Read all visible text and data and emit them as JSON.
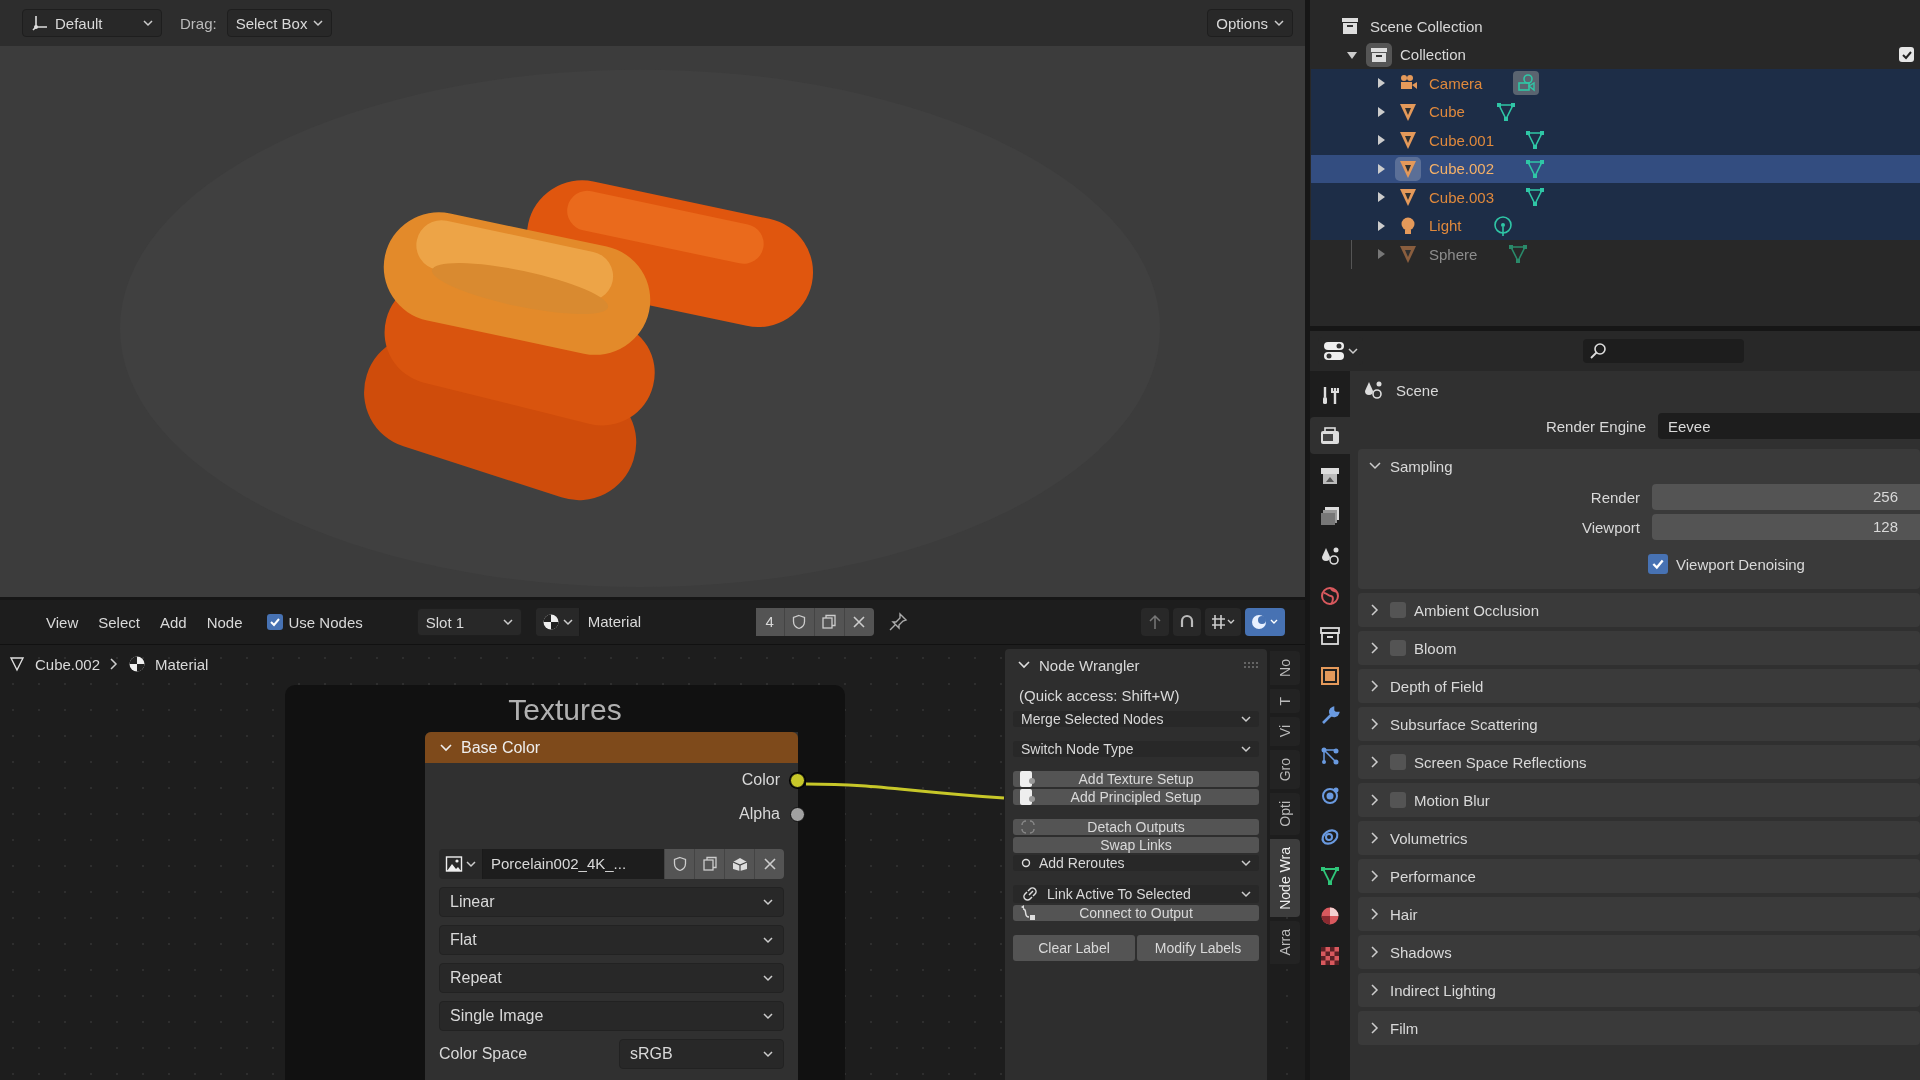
{
  "viewport": {
    "kind": "picture",
    "orientation": "Default",
    "drag_label": "Drag:",
    "drag_mode": "Select Box",
    "options": "Options"
  },
  "outliner": {
    "root": "Scene Collection",
    "collection": {
      "name": "Collection",
      "expanded": true,
      "checked": true,
      "children": [
        {
          "name": "Camera",
          "kind": "camera",
          "expanded": false,
          "selected": true,
          "active": false,
          "disabled": false
        },
        {
          "name": "Cube",
          "kind": "mesh",
          "expanded": false,
          "selected": true,
          "active": false,
          "disabled": false
        },
        {
          "name": "Cube.001",
          "kind": "mesh",
          "expanded": false,
          "selected": true,
          "active": false,
          "disabled": false
        },
        {
          "name": "Cube.002",
          "kind": "mesh",
          "expanded": false,
          "selected": true,
          "active": true,
          "disabled": false
        },
        {
          "name": "Cube.003",
          "kind": "mesh",
          "expanded": false,
          "selected": true,
          "active": false,
          "disabled": false
        },
        {
          "name": "Light",
          "kind": "light",
          "expanded": false,
          "selected": true,
          "active": false,
          "disabled": false
        },
        {
          "name": "Sphere",
          "kind": "mesh",
          "expanded": false,
          "selected": false,
          "active": false,
          "disabled": true
        }
      ]
    }
  },
  "node_editor": {
    "menus": [
      "View",
      "Select",
      "Add",
      "Node"
    ],
    "use_nodes": {
      "label": "Use Nodes",
      "checked": true
    },
    "slot": "Slot 1",
    "material": "Material",
    "users": "4",
    "header_toggles": [
      {
        "kind": "parent",
        "on": false
      },
      {
        "kind": "snap",
        "on": false
      },
      {
        "kind": "snap_mode",
        "on": false
      },
      {
        "kind": "overlay",
        "on": true
      }
    ],
    "breadcrumb": [
      {
        "kind": "mesh",
        "label": "Cube.002"
      },
      {
        "kind": "material",
        "label": "Material"
      }
    ],
    "frame": {
      "title": "Textures",
      "node": {
        "title": "Base Color",
        "outputs": [
          {
            "name": "Color",
            "kind": "color",
            "linked": true
          },
          {
            "name": "Alpha",
            "kind": "float",
            "linked": false
          }
        ],
        "image": "Porcelain002_4K_...",
        "dropdowns": [
          "Linear",
          "Flat",
          "Repeat",
          "Single Image"
        ],
        "color_space_label": "Color Space",
        "color_space": "sRGB"
      }
    }
  },
  "node_wrangler": {
    "title": "Node Wrangler",
    "hint": "(Quick access: Shift+W)",
    "groups": [
      {
        "items": [
          {
            "label": "Merge Selected Nodes",
            "kind": "dropdown"
          }
        ]
      },
      {
        "items": [
          {
            "label": "Switch Node Type",
            "kind": "dropdown"
          }
        ]
      },
      {
        "items": [
          {
            "label": "Add Texture Setup",
            "kind": "node_button"
          },
          {
            "label": "Add Principled Setup",
            "kind": "node_button"
          }
        ]
      },
      {
        "items": [
          {
            "label": "Detach Outputs",
            "kind": "detach_button"
          },
          {
            "label": "Swap Links",
            "kind": "button"
          },
          {
            "label": "Add Reroutes",
            "kind": "reroute_dropdown"
          }
        ]
      },
      {
        "items": [
          {
            "label": "Link Active To Selected",
            "kind": "link_dropdown"
          },
          {
            "label": "Connect to Output",
            "kind": "output_button"
          }
        ]
      }
    ],
    "label_buttons": [
      "Clear Label",
      "Modify Labels"
    ]
  },
  "sidebar_tabs": [
    {
      "label": "No",
      "selected": false
    },
    {
      "label": "T",
      "selected": false
    },
    {
      "label": "Vi",
      "selected": false
    },
    {
      "label": "Gro",
      "selected": false
    },
    {
      "label": "Opti",
      "selected": false
    },
    {
      "label": "Node Wra",
      "selected": true
    },
    {
      "label": "Arra",
      "selected": false
    }
  ],
  "properties": {
    "tabs": [
      {
        "kind": "tool",
        "selected": false
      },
      {
        "kind": "render",
        "selected": true
      },
      {
        "kind": "output",
        "selected": false
      },
      {
        "kind": "view_layer",
        "selected": false
      },
      {
        "kind": "scene",
        "selected": false
      },
      {
        "kind": "world",
        "selected": false
      },
      {
        "kind": "collection",
        "selected": false
      },
      {
        "kind": "object",
        "selected": false
      },
      {
        "kind": "modifiers",
        "selected": false
      },
      {
        "kind": "particles",
        "selected": false
      },
      {
        "kind": "physics",
        "selected": false
      },
      {
        "kind": "constraints",
        "selected": false
      },
      {
        "kind": "data",
        "selected": false
      },
      {
        "kind": "material",
        "selected": false
      },
      {
        "kind": "texture",
        "selected": false
      }
    ],
    "context": "Scene",
    "render_engine_label": "Render Engine",
    "render_engine": "Eevee",
    "sampling": {
      "title": "Sampling",
      "expanded": true,
      "fields": [
        {
          "label": "Render",
          "value": "256"
        },
        {
          "label": "Viewport",
          "value": "128"
        }
      ],
      "denoise": {
        "label": "Viewport Denoising",
        "checked": true
      }
    },
    "panels": [
      {
        "title": "Ambient Occlusion",
        "kind": "toggle",
        "checked": false
      },
      {
        "title": "Bloom",
        "kind": "toggle",
        "checked": false
      },
      {
        "title": "Depth of Field",
        "kind": "plain"
      },
      {
        "title": "Subsurface Scattering",
        "kind": "plain"
      },
      {
        "title": "Screen Space Reflections",
        "kind": "toggle",
        "checked": false
      },
      {
        "title": "Motion Blur",
        "kind": "toggle",
        "checked": false
      },
      {
        "title": "Volumetrics",
        "kind": "plain"
      },
      {
        "title": "Performance",
        "kind": "plain"
      },
      {
        "title": "Hair",
        "kind": "plain"
      },
      {
        "title": "Shadows",
        "kind": "plain"
      },
      {
        "title": "Indirect Lighting",
        "kind": "plain"
      },
      {
        "title": "Film",
        "kind": "plain"
      }
    ]
  }
}
